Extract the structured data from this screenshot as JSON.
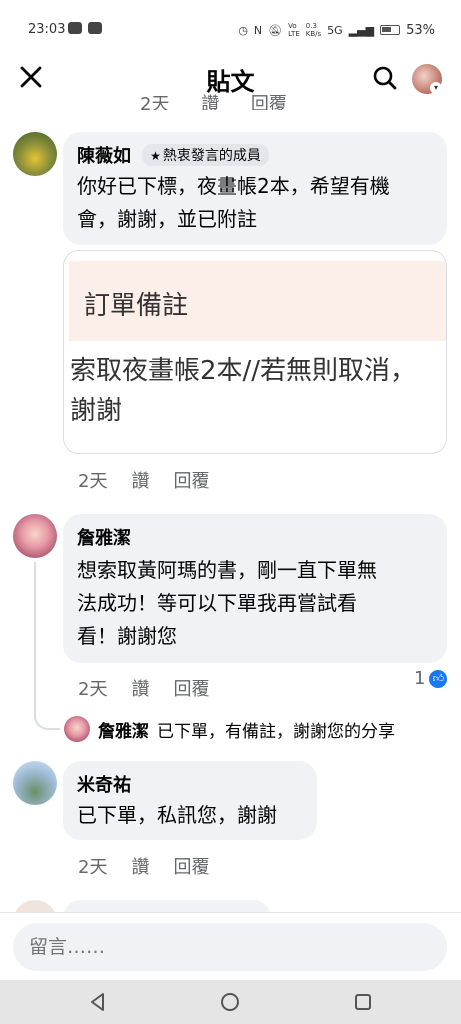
{
  "status_bar": {
    "time": "23:03",
    "net_label_1": "Vo\nLTE",
    "net_speed": "0.3\nKB/s",
    "network": "5G",
    "battery": "53%"
  },
  "header": {
    "title": "貼文",
    "icons": [
      "close-icon",
      "search-icon",
      "avatar"
    ]
  },
  "cut_off_actions": [
    "2天",
    "讚",
    "回覆"
  ],
  "comments": [
    {
      "author": "陳薇如",
      "badge": "熱衷發言的成員",
      "text": "你好已下標，夜畫帳2本，希望有機\n會，謝謝，並已附註",
      "note": {
        "title": "訂單備註",
        "body": "索取夜畫帳2本//若無則取消，\n謝謝"
      },
      "time": "2天",
      "like": "讚",
      "reply": "回覆"
    },
    {
      "author": "詹雅潔",
      "text": "想索取黃阿瑪的書，剛一直下單無\n法成功！等可以下單我再嘗試看\n看！謝謝您",
      "time": "2天",
      "like": "讚",
      "reply": "回覆",
      "like_count": "1",
      "reply_preview": {
        "author": "詹雅潔",
        "text": "已下單，有備註，謝謝您的分享"
      }
    },
    {
      "author": "米奇祐",
      "text": "已下單，私訊您，謝謝",
      "time": "2天",
      "like": "讚",
      "reply": "回覆"
    }
  ],
  "composer": {
    "placeholder": "留言……"
  },
  "colors": {
    "bubble": "#f0f2f5",
    "meta_text": "#65676b",
    "like_blue": "#1877f2",
    "note_header": "#fcefe9"
  }
}
